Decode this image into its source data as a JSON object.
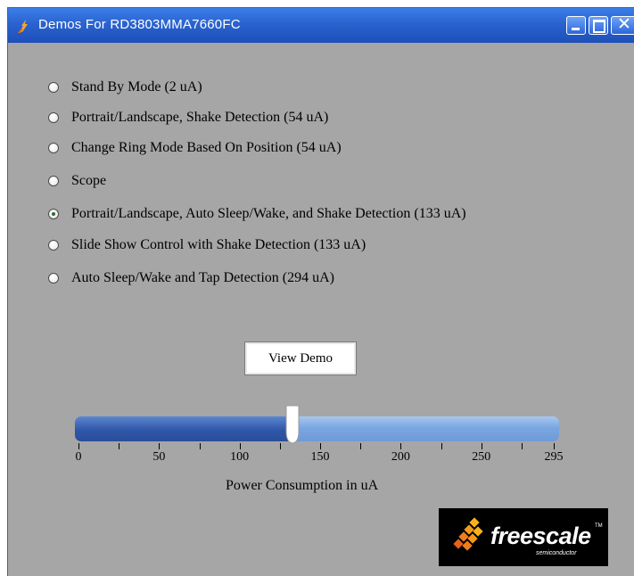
{
  "window": {
    "title": "Demos For RD3803MMA7660FC"
  },
  "options": [
    {
      "label": "Stand By Mode (2 uA)",
      "checked": false
    },
    {
      "label": "Portrait/Landscape, Shake Detection (54 uA)",
      "checked": false
    },
    {
      "label": "Change Ring Mode Based On Position (54 uA)",
      "checked": false
    },
    {
      "label": "Scope",
      "checked": false
    },
    {
      "label": "Portrait/Landscape, Auto Sleep/Wake, and Shake Detection (133 uA)",
      "checked": true
    },
    {
      "label": "Slide Show Control with Shake Detection (133 uA)",
      "checked": false
    },
    {
      "label": "Auto Sleep/Wake and Tap Detection (294 uA)",
      "checked": false
    }
  ],
  "view_demo_label": "View Demo",
  "slider": {
    "value": 133,
    "min": 0,
    "max": 295,
    "tick_labels": [
      "0",
      "50",
      "100",
      "150",
      "200",
      "250",
      "295"
    ],
    "axis_title": "Power Consumption in uA"
  },
  "logo": {
    "text": "freescale",
    "subtext": "semiconductor",
    "trademark": "TM"
  },
  "colors": {
    "window_bg": "#a6a6a6",
    "titlebar": "#2a63cf",
    "slider_fill": "#2f56a8",
    "slider_track": "#7aa6e2"
  }
}
